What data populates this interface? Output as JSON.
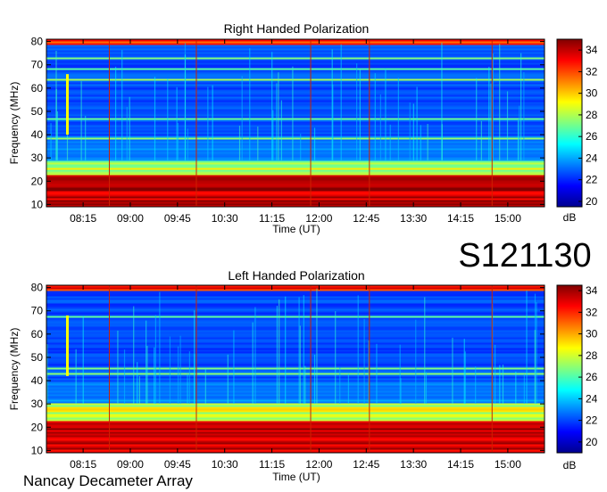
{
  "station_code": "S121130",
  "footer_label": "Nancay Decameter Array",
  "chart_data": [
    {
      "type": "heatmap",
      "title": "Right Handed Polarization",
      "xlabel": "Time (UT)",
      "ylabel": "Frequency (MHz)",
      "x_ticks": [
        "08:15",
        "09:00",
        "09:45",
        "10:30",
        "11:15",
        "12:00",
        "12:45",
        "13:30",
        "14:15",
        "15:00"
      ],
      "x_range": [
        "07:40",
        "15:35"
      ],
      "y_ticks": [
        10,
        20,
        30,
        40,
        50,
        60,
        70,
        80
      ],
      "y_range": [
        9,
        81
      ],
      "colorbar": {
        "label": "dB",
        "ticks": [
          20,
          22,
          24,
          26,
          28,
          30,
          32,
          34
        ],
        "range": [
          19.5,
          35
        ]
      },
      "features": {
        "strong_band_MHz": [
          10,
          23
        ],
        "enhanced_band_MHz": [
          23,
          29
        ],
        "burst": {
          "time": "08:00",
          "freq_MHz": [
            40,
            66
          ]
        },
        "vertical_lines": [
          "08:40",
          "10:03",
          "11:52",
          "12:48",
          "14:45"
        ]
      }
    },
    {
      "type": "heatmap",
      "title": "Left Handed Polarization",
      "xlabel": "Time (UT)",
      "ylabel": "Frequency (MHz)",
      "x_ticks": [
        "08:15",
        "09:00",
        "09:45",
        "10:30",
        "11:15",
        "12:00",
        "12:45",
        "13:30",
        "14:15",
        "15:00"
      ],
      "x_range": [
        "07:40",
        "15:35"
      ],
      "y_ticks": [
        10,
        20,
        30,
        40,
        50,
        60,
        70,
        80
      ],
      "y_range": [
        9,
        81
      ],
      "colorbar": {
        "label": "dB",
        "ticks": [
          20,
          22,
          24,
          26,
          28,
          30,
          32,
          34
        ],
        "range": [
          19,
          34.5
        ]
      },
      "features": {
        "strong_band_MHz": [
          10,
          22
        ],
        "enhanced_band_MHz": [
          22,
          30
        ],
        "burst": {
          "time": "08:00",
          "freq_MHz": [
            42,
            68
          ]
        },
        "vertical_lines": [
          "08:40",
          "10:03",
          "11:52",
          "12:48",
          "14:45"
        ]
      }
    }
  ]
}
